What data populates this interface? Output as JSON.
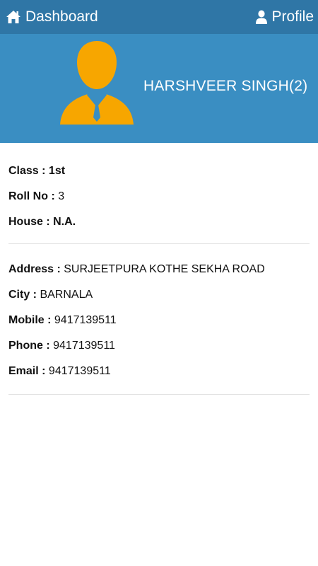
{
  "header": {
    "dashboard_label": "Dashboard",
    "profile_label": "Profile",
    "icons": {
      "dashboard": "home-icon",
      "profile": "user-icon"
    }
  },
  "student": {
    "name": "HARSHVEER SINGH(2)",
    "avatar_icon": "user-avatar-icon"
  },
  "academic": {
    "class_label": "Class :",
    "class_value": "1st",
    "roll_label": "Roll No :",
    "roll_value": "3",
    "house_label": "House :",
    "house_value": "N.A."
  },
  "contact": {
    "address_label": "Address :",
    "address_value": "SURJEETPURA KOTHE SEKHA ROAD",
    "city_label": "City :",
    "city_value": "BARNALA",
    "mobile_label": "Mobile :",
    "mobile_value": "9417139511",
    "phone_label": "Phone :",
    "phone_value": "9417139511",
    "email_label": "Email :",
    "email_value": "9417139511"
  },
  "colors": {
    "topbar": "#2f76a6",
    "hero": "#3a8ec2",
    "avatar": "#f7a600"
  }
}
